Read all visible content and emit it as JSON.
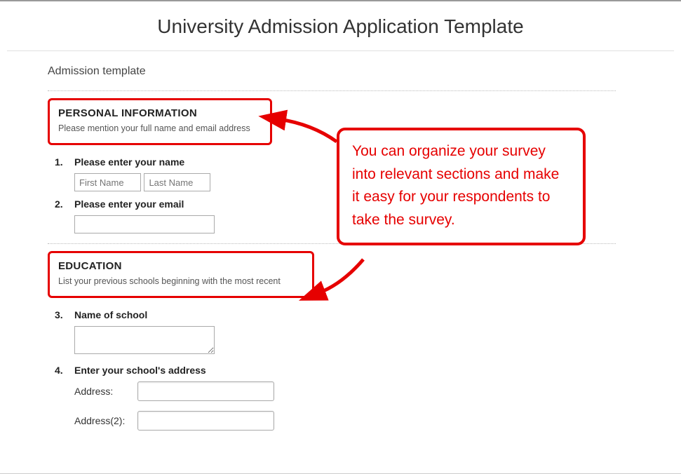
{
  "title": "University Admission Application Template",
  "subtitle": "Admission template",
  "sections": [
    {
      "heading": "PERSONAL INFORMATION",
      "desc": "Please mention your full name and email address"
    },
    {
      "heading": "EDUCATION",
      "desc": "List your previous schools beginning with the most recent"
    }
  ],
  "questions": [
    {
      "num": "1.",
      "label": "Please enter your name"
    },
    {
      "num": "2.",
      "label": "Please enter your email"
    },
    {
      "num": "3.",
      "label": "Name of school"
    },
    {
      "num": "4.",
      "label": "Enter your school's address"
    }
  ],
  "placeholders": {
    "first_name": "First Name",
    "last_name": "Last Name"
  },
  "address_labels": {
    "a1": "Address:",
    "a2": "Address(2):"
  },
  "callout": "You can organize your survey into relevant sections and make it easy for your respondents to take the survey.",
  "colors": {
    "annotation": "#e60000"
  }
}
